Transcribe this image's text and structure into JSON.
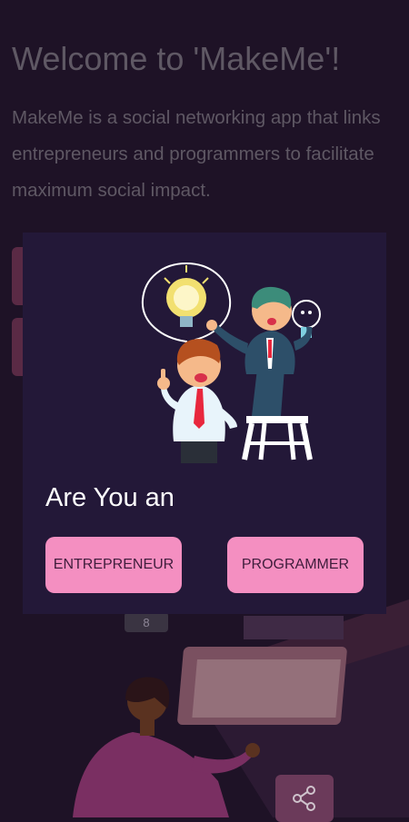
{
  "background": {
    "title": "Welcome to 'MakeMe'!",
    "description": "MakeMe is a social networking app that links entrepreneurs and programmers to facilitate maximum social impact.",
    "badge_text": "8",
    "share_icon": "share-icon"
  },
  "dialog": {
    "illustration": "two-businessmen-idea-lightbulb-illustration",
    "question": "Are You an",
    "options": [
      {
        "label": "ENTREPRENEUR"
      },
      {
        "label": "PROGRAMMER"
      }
    ]
  },
  "colors": {
    "background": "#1e1226",
    "dialog": "#231838",
    "button": "#f48fc1",
    "button_text": "#3f1d3c",
    "muted_text": "#5f5864"
  }
}
